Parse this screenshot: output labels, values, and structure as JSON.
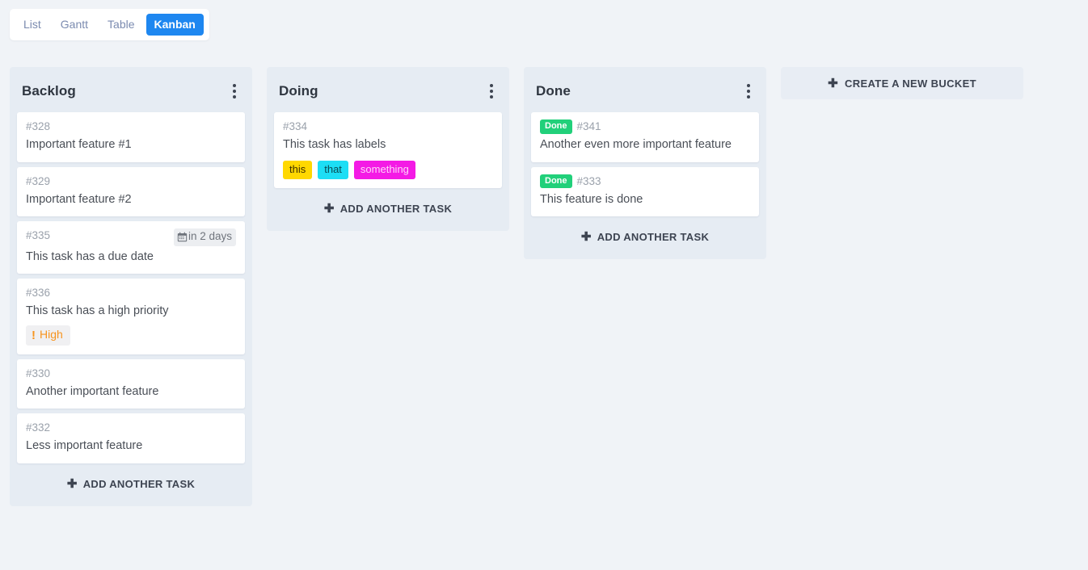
{
  "view_switcher": {
    "tabs": [
      {
        "label": "List",
        "active": false
      },
      {
        "label": "Gantt",
        "active": false
      },
      {
        "label": "Table",
        "active": false
      },
      {
        "label": "Kanban",
        "active": true
      }
    ]
  },
  "board": {
    "add_task_label": "ADD ANOTHER TASK",
    "new_bucket_label": "CREATE A NEW BUCKET",
    "accent_blue": "#1e87f0",
    "done_green": "#21d07a",
    "priority_orange": "#f7941e",
    "buckets": [
      {
        "title": "Backlog",
        "cards": [
          {
            "id": "#328",
            "title": "Important feature #1"
          },
          {
            "id": "#329",
            "title": "Important feature #2"
          },
          {
            "id": "#335",
            "title": "This task has a due date",
            "due": "in 2 days"
          },
          {
            "id": "#336",
            "title": "This task has a high priority",
            "priority": "High"
          },
          {
            "id": "#330",
            "title": "Another important feature"
          },
          {
            "id": "#332",
            "title": "Less important feature"
          }
        ]
      },
      {
        "title": "Doing",
        "cards": [
          {
            "id": "#334",
            "title": "This task has labels",
            "labels": [
              {
                "text": "this",
                "bg": "#ffd800",
                "fg": "#3d3000"
              },
              {
                "text": "that",
                "bg": "#1ddef5",
                "fg": "#0a4a52"
              },
              {
                "text": "something",
                "bg": "#f41ae5",
                "fg": "#ffd4fa"
              }
            ]
          }
        ]
      },
      {
        "title": "Done",
        "cards": [
          {
            "id": "#341",
            "title": "Another even more important feature",
            "done_label": "Done"
          },
          {
            "id": "#333",
            "title": "This feature is done",
            "done_label": "Done"
          }
        ]
      }
    ]
  }
}
